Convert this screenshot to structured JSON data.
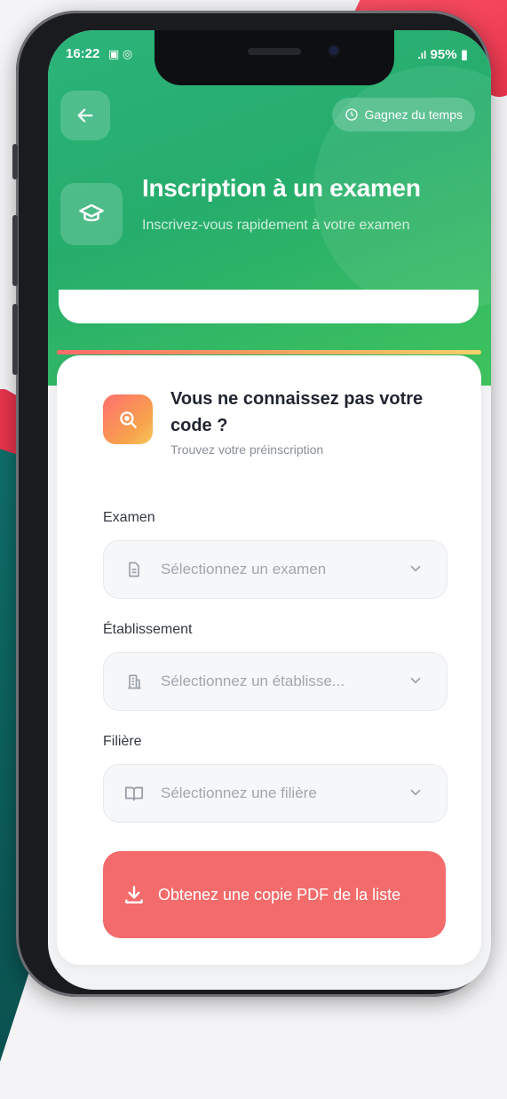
{
  "status": {
    "time": "16:22",
    "battery": "95%"
  },
  "header": {
    "chip_label": "Gagnez du temps",
    "title": "Inscription à un examen",
    "subtitle": "Inscrivez-vous rapidement à votre examen"
  },
  "card": {
    "find": {
      "title": "Vous ne connaissez pas votre code ?",
      "subtitle": "Trouvez votre préinscription"
    },
    "fields": {
      "examen_label": "Examen",
      "examen_placeholder": "Sélectionnez un examen",
      "etablissement_label": "Établissement",
      "etablissement_placeholder": "Sélectionnez un établisse...",
      "filiere_label": "Filière",
      "filiere_placeholder": "Sélectionnez une filière"
    },
    "pdf_button": "Obtenez une copie PDF de la liste"
  },
  "icons": {
    "back": "arrow-left-icon",
    "chip": "clock-icon",
    "header": "graduation-cap-icon",
    "find": "search-icon",
    "examen": "document-icon",
    "etablissement": "building-icon",
    "filiere": "book-icon",
    "dropdown": "chevron-down-icon",
    "pdf": "download-icon"
  },
  "colors": {
    "header_green": "#26ad6c",
    "pdf_button": "#f36b6b",
    "accent_orange": "#f7a34c"
  }
}
